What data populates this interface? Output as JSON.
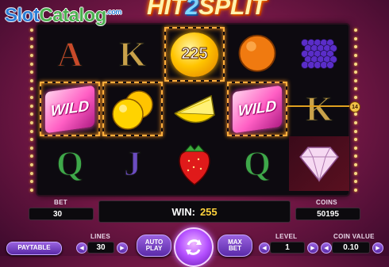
{
  "watermark": {
    "part_a": "Slot",
    "part_b": "Catalog",
    "sup": ".com"
  },
  "game_logo": {
    "part1": "HIT",
    "part2": "2",
    "part3": "SPLIT"
  },
  "reels": {
    "cells": [
      {
        "col": 0,
        "row": 0,
        "symbol": "A",
        "kind": "letter"
      },
      {
        "col": 1,
        "row": 0,
        "symbol": "K",
        "kind": "letter"
      },
      {
        "col": 2,
        "row": 0,
        "symbol": "225",
        "kind": "coin",
        "highlight": true
      },
      {
        "col": 3,
        "row": 0,
        "symbol": "orange",
        "kind": "orange"
      },
      {
        "col": 4,
        "row": 0,
        "symbol": "raspberry",
        "kind": "berry"
      },
      {
        "col": 0,
        "row": 1,
        "symbol": "WILD",
        "kind": "wild",
        "highlight": true
      },
      {
        "col": 1,
        "row": 1,
        "symbol": "orange",
        "kind": "double-orange",
        "highlight": true
      },
      {
        "col": 2,
        "row": 1,
        "symbol": "lemon",
        "kind": "lemon"
      },
      {
        "col": 3,
        "row": 1,
        "symbol": "WILD",
        "kind": "wild",
        "highlight": true
      },
      {
        "col": 4,
        "row": 1,
        "symbol": "K",
        "kind": "letter"
      },
      {
        "col": 0,
        "row": 2,
        "symbol": "Q",
        "kind": "letter"
      },
      {
        "col": 1,
        "row": 2,
        "symbol": "J",
        "kind": "letter"
      },
      {
        "col": 2,
        "row": 2,
        "symbol": "strawberry",
        "kind": "strawberry"
      },
      {
        "col": 3,
        "row": 2,
        "symbol": "Q",
        "kind": "letter"
      },
      {
        "col": 4,
        "row": 2,
        "symbol": "diamond",
        "kind": "diamond"
      }
    ],
    "payline_number": "14"
  },
  "bet": {
    "label": "BET",
    "value": "30"
  },
  "win": {
    "label": "WIN:",
    "value": "255"
  },
  "coins": {
    "label": "COINS",
    "value": "50195"
  },
  "controls": {
    "paytable": "PAYTABLE",
    "lines_label": "LINES",
    "lines_value": "30",
    "autoplay_line1": "AUTO",
    "autoplay_line2": "PLAY",
    "maxbet_line1": "MAX",
    "maxbet_line2": "BET",
    "level_label": "LEVEL",
    "level_value": "1",
    "coin_value_label": "COIN VALUE",
    "coin_value": "0.10"
  },
  "colors": {
    "accent_gold": "#ffd23c",
    "button_purple": "#7a40c8",
    "highlight_orange": "#ffae3c"
  }
}
